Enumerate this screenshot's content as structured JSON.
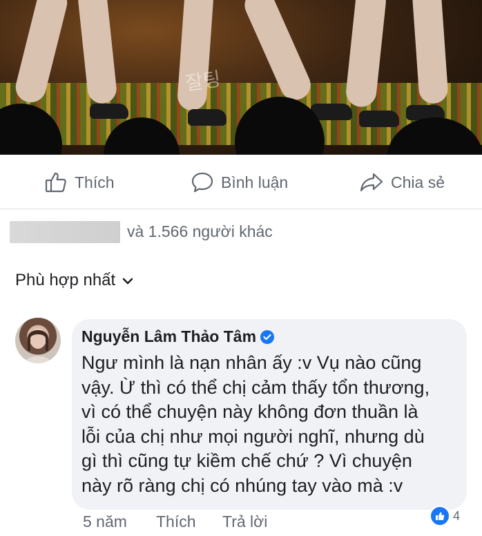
{
  "post": {
    "actions": [
      {
        "label": "Thích",
        "icon": "thumbs-up-icon"
      },
      {
        "label": "Bình luận",
        "icon": "comment-icon"
      },
      {
        "label": "Chia sẻ",
        "icon": "share-icon"
      }
    ],
    "likes_summary": "và 1.566 người khác",
    "sort_label": "Phù hợp nhất",
    "photo_watermark": "잘팅"
  },
  "comment": {
    "author": "Nguyễn Lâm Thảo Tâm",
    "verified": true,
    "text_lines": [
      "Ngư mình là nạn nhân ấy :v Vụ nào cũng",
      "vậy. Ừ thì có thể chị cảm thấy tổn thương,",
      "vì có thể chuyện này không đơn thuần là",
      "lỗi của chị như mọi người nghĩ, nhưng dù",
      "gì thì cũng tự kiềm chế chứ ? Vì chuyện",
      "này rõ ràng chị có nhúng tay vào mà :v"
    ],
    "time": "5 năm",
    "like_label": "Thích",
    "reply_label": "Trả lời",
    "reaction_count": "4"
  },
  "colors": {
    "accent": "#1877f2",
    "secondary_text": "#606770",
    "bubble": "#f0f2f5"
  }
}
